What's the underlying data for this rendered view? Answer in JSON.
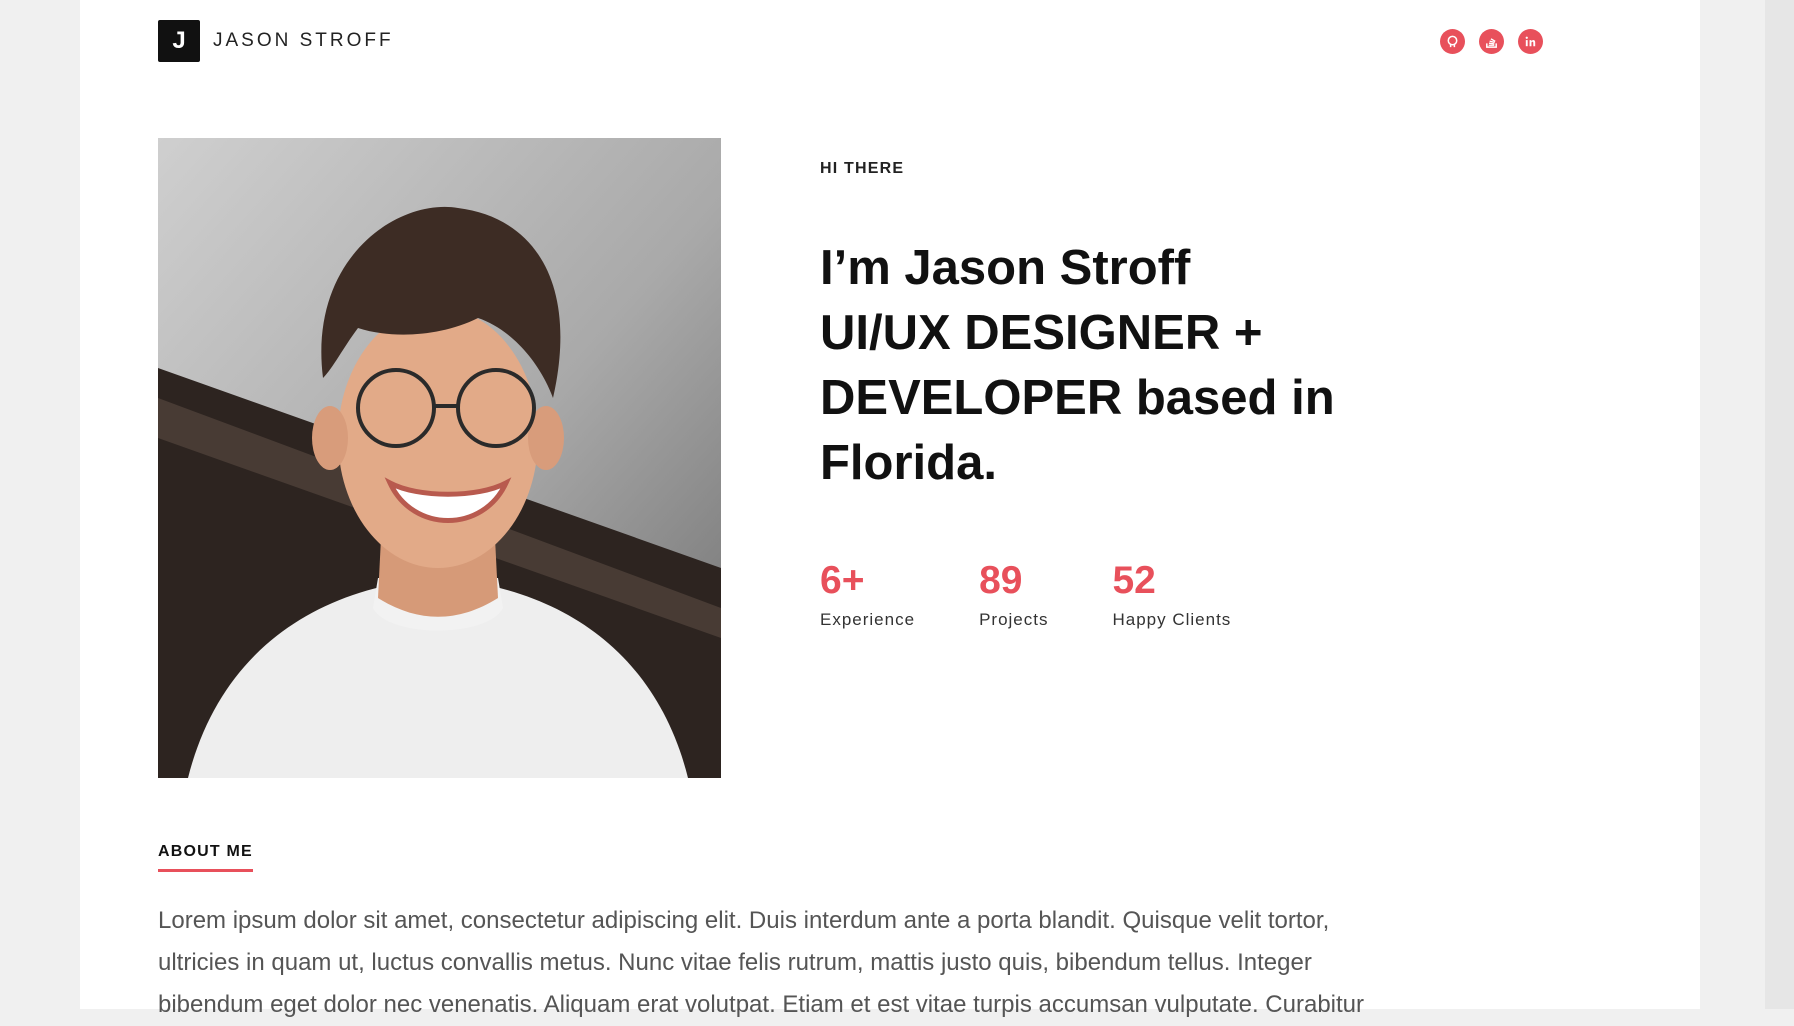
{
  "brand": {
    "initial": "J",
    "name": "JASON STROFF"
  },
  "social": [
    {
      "icon": "github-icon",
      "color": "#e8505b"
    },
    {
      "icon": "stackoverflow-icon",
      "color": "#e8505b"
    },
    {
      "icon": "linkedin-icon",
      "color": "#e8505b"
    }
  ],
  "hero": {
    "eyebrow": "HI THERE",
    "headline_lines": [
      "I’m Jason Stroff",
      "UI/UX DESIGNER +",
      "DEVELOPER based in",
      "Florida."
    ]
  },
  "stats": [
    {
      "value": "6+",
      "label": "Experience"
    },
    {
      "value": "89",
      "label": "Projects"
    },
    {
      "value": "52",
      "label": "Happy Clients"
    }
  ],
  "about": {
    "title": "ABOUT ME",
    "lines": [
      "Lorem ipsum dolor sit amet, consectetur adipiscing elit. Duis interdum ante a porta blandit. Quisque velit tortor,",
      "ultricies in quam ut, luctus convallis metus. Nunc vitae felis rutrum, mattis justo quis, bibendum tellus. Integer",
      "bibendum eget dolor nec venenatis. Aliquam erat volutpat. Etiam et est vitae turpis accumsan vulputate. Curabitur"
    ]
  },
  "colors": {
    "accent": "#e8505b",
    "brand_bg": "#111111"
  }
}
